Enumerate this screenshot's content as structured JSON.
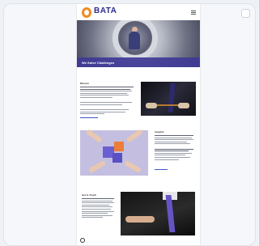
{
  "brand": {
    "name": "BATA",
    "tagline": "",
    "accent": "#2d2a8c",
    "logo_color": "#f08a24"
  },
  "hero": {
    "title": "We Solve Challenges",
    "subtitle": "",
    "panel_color": "#403a96"
  },
  "sections": [
    {
      "title": "Mission"
    },
    {
      "title": "Insights"
    },
    {
      "title": "Get in Touch"
    }
  ],
  "icons": {
    "menu": "hamburger-menu-icon",
    "footer": "circle-icon"
  }
}
